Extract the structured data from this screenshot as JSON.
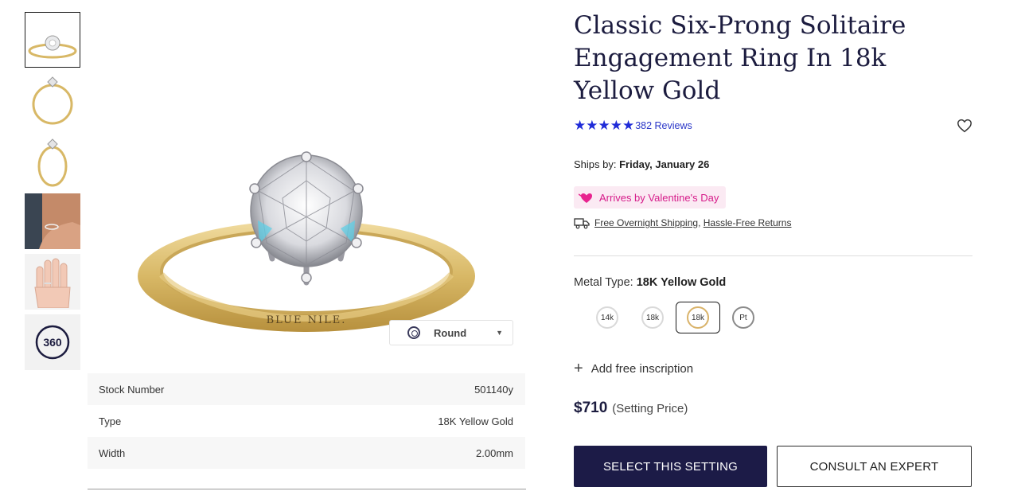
{
  "thumbnails": [
    {
      "alt": "ring-front"
    },
    {
      "alt": "ring-side"
    },
    {
      "alt": "ring-angle"
    },
    {
      "alt": "ring-on-hand-closeup"
    },
    {
      "alt": "ring-on-hand"
    },
    {
      "alt": "360-view",
      "label": "360"
    }
  ],
  "main_image": {
    "engraving": "BLUE NILE.",
    "shape_select": {
      "value": "Round"
    }
  },
  "specs": [
    {
      "label": "Stock Number",
      "value": "501140y"
    },
    {
      "label": "Type",
      "value": "18K Yellow Gold"
    },
    {
      "label": "Width",
      "value": "2.00mm"
    }
  ],
  "product": {
    "title": "Classic Six-Prong Solitaire Engagement Ring In 18k Yellow Gold",
    "stars": "★★★★★",
    "reviews": "382 Reviews",
    "ships_label": "Ships by:",
    "ships_date": "Friday, January 26",
    "valentine": "Arrives by Valentine's Day",
    "shipping_link": "Free Overnight Shipping",
    "shipping_sep": ",",
    "returns_link": "Hassle-Free Returns",
    "metal_label": "Metal Type:",
    "metal_value": "18K Yellow Gold",
    "metals": [
      {
        "label": "14k"
      },
      {
        "label": "18k"
      },
      {
        "label": "18k"
      },
      {
        "label": "Pt"
      }
    ],
    "inscription": "Add free inscription",
    "price": "$710",
    "price_note": "(Setting Price)",
    "select_button": "SELECT THIS SETTING",
    "consult_button": "CONSULT AN EXPERT"
  },
  "colors": {
    "navy": "#1c1b47",
    "star_blue": "#1f2bd8",
    "valentine_pink": "#d61c8a",
    "gold": "#d9b36a"
  }
}
